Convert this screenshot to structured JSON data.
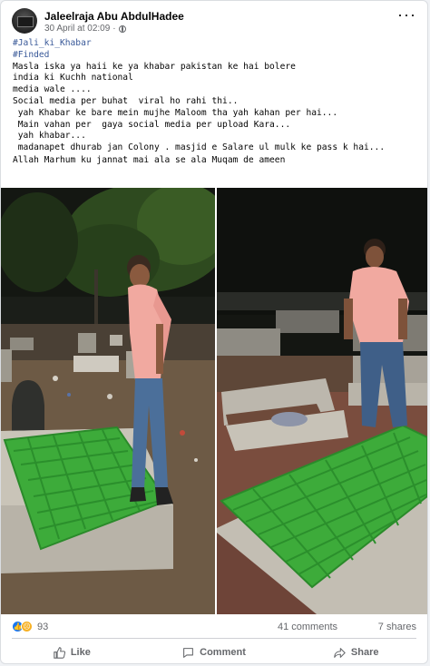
{
  "post": {
    "author": "Jaleelraja Abu AbdulHadee",
    "timestamp": "30 April at 02:09",
    "separator": "·",
    "privacy_icon": "globe-icon",
    "more_icon": "more-options-icon",
    "hashtags": [
      "#Jali_ki_Khabar",
      "#Finded"
    ],
    "lines": [
      "Masla iska ya haii ke ya khabar pakistan ke hai bolere",
      "india ki Kuchh national",
      "media wale ....",
      "Social media per buhat  viral ho rahi thi..",
      " yah Khabar ke bare mein mujhe Maloom tha yah kahan per hai...",
      " Main vahan per  gaya social media per upload Kara...",
      " yah khabar...",
      " madanapet dhurab jan Colony . masjid e Salare ul mulk ke pass k hai...",
      "Allah Marhum ku jannat mai ala se ala Muqam de ameen"
    ]
  },
  "photos": [
    {
      "name": "photo-left",
      "subject": "man-standing-beside-grave-with-green-grate"
    },
    {
      "name": "photo-right",
      "subject": "man-standing-beside-grave-with-green-grate"
    }
  ],
  "stats": {
    "reaction_icons": [
      "like-icon",
      "sad-icon"
    ],
    "reactions": "93",
    "comments": "41 comments",
    "shares": "7 shares"
  },
  "actions": {
    "like": "Like",
    "comment": "Comment",
    "share": "Share"
  },
  "colors": {
    "hashtag": "#385898",
    "like_blue": "#1877f2",
    "grate_green": "#3dab3a",
    "secondary_text": "#65676b"
  }
}
